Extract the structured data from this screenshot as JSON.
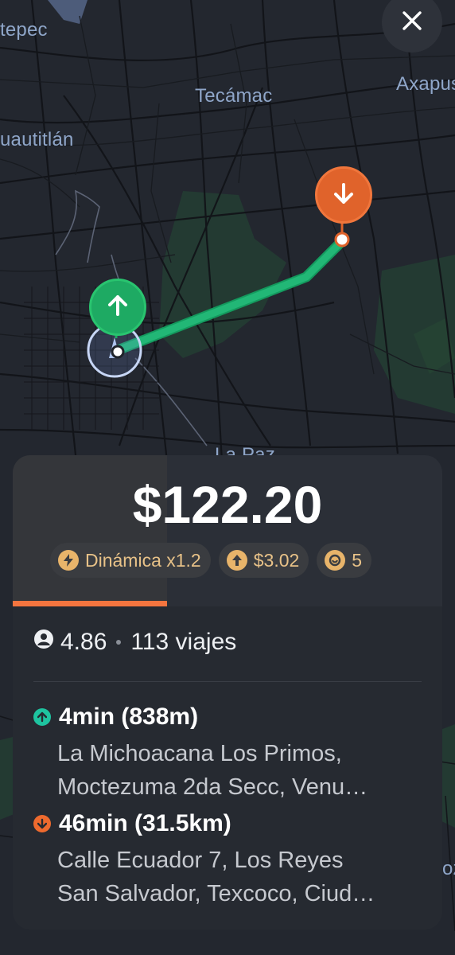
{
  "map": {
    "labels": [
      "tepec",
      "Tecámac",
      "Axapus",
      "uautitlán",
      "La Paz",
      "ozi"
    ]
  },
  "close_button": {
    "icon": "close-icon"
  },
  "pins": {
    "pickup_icon": "arrow-up-icon",
    "dropoff_icon": "arrow-down-icon"
  },
  "offer": {
    "price": "$122.20",
    "timer_progress": 0.36,
    "chips": [
      {
        "icon": "bolt-icon",
        "label": "Dinámica x1.2"
      },
      {
        "icon": "arrow-up-circle-icon",
        "label": "$3.02"
      },
      {
        "icon": "coin-icon",
        "label": "5"
      }
    ],
    "rider": {
      "rating": "4.86",
      "trips": "113 viajes"
    },
    "pickup": {
      "eta": "4min (838m)",
      "address_line1": "La Michoacana Los Primos,",
      "address_line2": "Moctezuma 2da Secc, Venu…"
    },
    "dropoff": {
      "eta": "46min (31.5km)",
      "address_line1": "Calle Ecuador 7, Los Reyes",
      "address_line2": "San Salvador, Texcoco, Ciud…"
    }
  },
  "colors": {
    "pickup": "#1eaa63",
    "dropoff": "#e0632b",
    "route": "#22b776",
    "accent_timer": "#f5753f",
    "chip_text": "#e8c288"
  }
}
